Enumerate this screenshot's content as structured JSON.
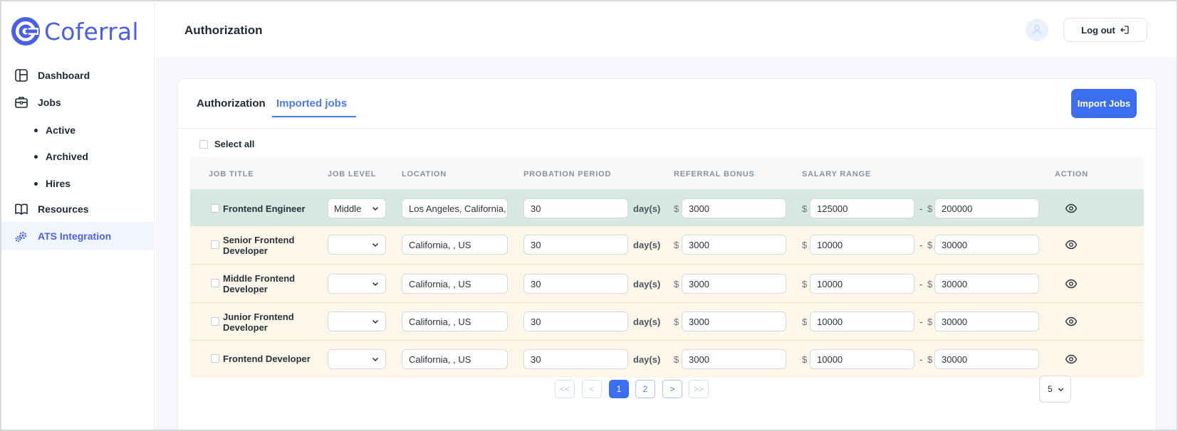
{
  "brand": {
    "name": "Coferral",
    "color": "#4a5fe5"
  },
  "sidebar": {
    "items": [
      {
        "label": "Dashboard",
        "icon": "layout-icon"
      },
      {
        "label": "Jobs",
        "icon": "briefcase-icon"
      },
      {
        "label": "Active"
      },
      {
        "label": "Archived"
      },
      {
        "label": "Hires"
      },
      {
        "label": "Resources",
        "icon": "book-icon"
      },
      {
        "label": "ATS Integration",
        "icon": "gears-icon",
        "active": true
      }
    ]
  },
  "header": {
    "title": "Authorization",
    "logout_label": "Log out"
  },
  "tabs": [
    {
      "label": "Authorization"
    },
    {
      "label": "Imported jobs",
      "active": true
    }
  ],
  "import_button": "Import Jobs",
  "select_all_label": "Select all",
  "table": {
    "columns": [
      "JOB TITLE",
      "JOB LEVEL",
      "LOCATION",
      "PROBATION PERIOD",
      "REFERRAL BONUS",
      "SALARY RANGE",
      "ACTION"
    ],
    "period_unit": "day(s)",
    "currency": "$",
    "range_separator": "-",
    "rows": [
      {
        "title": "Frontend Engineer",
        "level": "Middle",
        "location": "Los Angeles, California,",
        "probation": "30",
        "bonus": "3000",
        "salary_min": "125000",
        "salary_max": "200000",
        "highlight": true
      },
      {
        "title": "Senior Frontend Developer",
        "level": "",
        "location": "California, , US",
        "probation": "30",
        "bonus": "3000",
        "salary_min": "10000",
        "salary_max": "30000"
      },
      {
        "title": "Middle Frontend Developer",
        "level": "",
        "location": "California, , US",
        "probation": "30",
        "bonus": "3000",
        "salary_min": "10000",
        "salary_max": "30000"
      },
      {
        "title": "Junior Frontend Developer",
        "level": "",
        "location": "California, , US",
        "probation": "30",
        "bonus": "3000",
        "salary_min": "10000",
        "salary_max": "30000"
      },
      {
        "title": "Frontend Developer",
        "level": "",
        "location": "California, , US",
        "probation": "30",
        "bonus": "3000",
        "salary_min": "10000",
        "salary_max": "30000"
      }
    ]
  },
  "pagination": {
    "first": "<<",
    "prev": "<",
    "pages": [
      "1",
      "2"
    ],
    "current": "1",
    "next": ">",
    "last": ">>",
    "page_size": "5"
  },
  "colors": {
    "accent": "#3b6ff0",
    "highlight_row": "#d6e8df",
    "cream_row": "#fdf7e9"
  }
}
